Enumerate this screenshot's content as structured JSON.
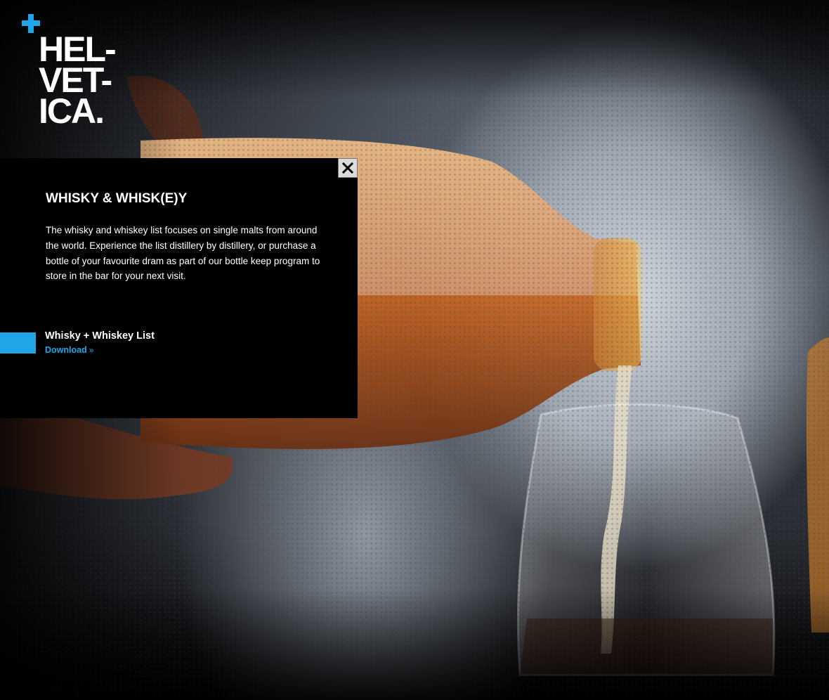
{
  "brand": {
    "logo_lines": [
      "HEL-",
      "VET-",
      "ICA."
    ],
    "accent_color": "#1fa6e8"
  },
  "panel": {
    "title": "WHISKY & WHISK(E)Y",
    "body": "The whisky and whiskey list focuses on single malts from around the world. Experience the list distillery by distillery, or purchase a bottle of your favourite dram as part of our bottle keep program to store in the bar for your next visit.",
    "close_icon": "close-icon",
    "list_title": "Whisky + Whiskey List",
    "download_label": "Download",
    "download_icon": "double-chevron-right-icon"
  }
}
